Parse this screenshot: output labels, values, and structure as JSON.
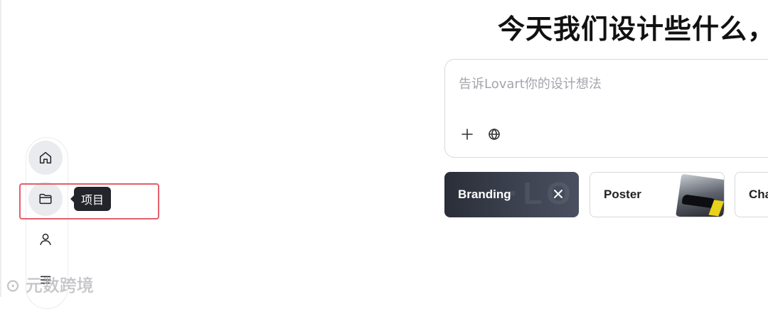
{
  "heading": "今天我们设计些什么，",
  "sidebar": {
    "items": [
      {
        "name": "home",
        "icon": "home-icon"
      },
      {
        "name": "projects",
        "icon": "folder-icon",
        "tooltip": "项目"
      },
      {
        "name": "profile",
        "icon": "user-icon"
      },
      {
        "name": "menu",
        "icon": "menu-icon"
      }
    ]
  },
  "prompt": {
    "placeholder": "告诉Lovart你的设计想法",
    "value": "",
    "tools": [
      "plus-icon",
      "globe-icon"
    ]
  },
  "chips": [
    {
      "label": "Branding",
      "selected": true
    },
    {
      "label": "Poster",
      "selected": false
    },
    {
      "label": "Cha",
      "selected": false
    }
  ],
  "watermark": "元数跨境",
  "colors": {
    "highlight": "#e2606a",
    "tooltip_bg": "#23252b",
    "chip_selected": "#2a2e38"
  }
}
